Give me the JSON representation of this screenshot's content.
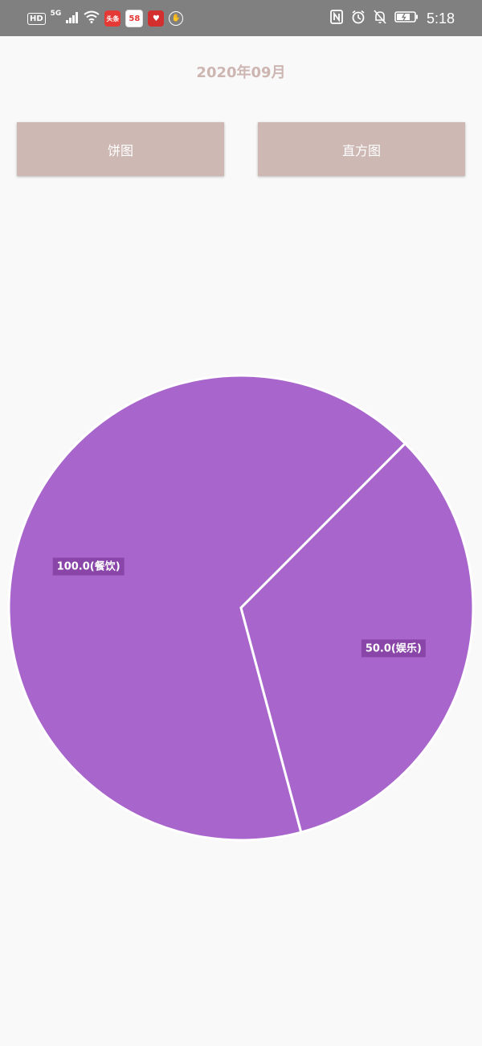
{
  "status_bar": {
    "hd": "HD",
    "network": "5G",
    "toutiao": "头条",
    "app58": "58",
    "time": "5:18"
  },
  "header": {
    "month": "2020年09月"
  },
  "buttons": {
    "pie": "饼图",
    "histogram": "直方图"
  },
  "colors": {
    "slice": "#a866cc",
    "label_bg": "#8a45a8",
    "button": "#cdb8b4",
    "title": "#cdb6b2"
  },
  "chart_data": {
    "type": "pie",
    "slices": [
      {
        "value": 100.0,
        "category": "餐饮",
        "label": "100.0(餐饮)"
      },
      {
        "value": 50.0,
        "category": "娱乐",
        "label": "50.0(娱乐)"
      }
    ],
    "title": "",
    "legend": "none"
  }
}
